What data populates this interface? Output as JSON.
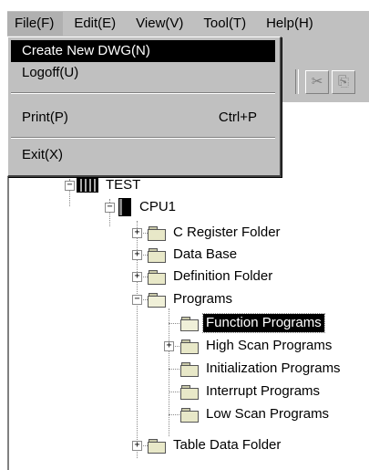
{
  "menubar": {
    "items": [
      {
        "label": "File(F)",
        "open": true
      },
      {
        "label": "Edit(E)"
      },
      {
        "label": "View(V)"
      },
      {
        "label": "Tool(T)"
      },
      {
        "label": "Help(H)"
      }
    ]
  },
  "file_menu": {
    "items": [
      {
        "label": "Create New DWG(N)",
        "highlighted": true
      },
      {
        "label": "Logoff(U)"
      },
      {
        "label": "Print(P)",
        "shortcut": "Ctrl+P"
      },
      {
        "label": "Exit(X)"
      }
    ]
  },
  "toolbar": {
    "icons": [
      "cut-icon",
      "paste-icon"
    ]
  },
  "tree": {
    "root": {
      "label": "TEST",
      "expander": "−"
    },
    "cpu": {
      "label": "CPU1",
      "expander": "−"
    },
    "folders": [
      {
        "label": "C Register Folder",
        "expander": "+"
      },
      {
        "label": "Data Base",
        "expander": "+"
      },
      {
        "label": "Definition Folder",
        "expander": "+"
      },
      {
        "label": "Programs",
        "expander": "−"
      }
    ],
    "programs": [
      {
        "label": "Function Programs",
        "selected": true
      },
      {
        "label": "High Scan Programs",
        "expander": "+"
      },
      {
        "label": "Initialization Programs"
      },
      {
        "label": "Interrupt Programs"
      },
      {
        "label": "Low Scan Programs"
      }
    ],
    "last_folder": {
      "label": "Table Data Folder",
      "expander": "+"
    }
  }
}
